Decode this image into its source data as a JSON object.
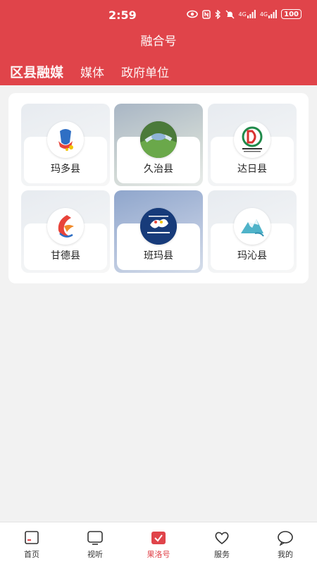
{
  "status_bar": {
    "time": "2:59",
    "icons": [
      "eye-icon",
      "nfc-icon",
      "bluetooth-icon",
      "mute-icon",
      "signal-4g-icon",
      "signal-4g-icon"
    ],
    "signal_label": "4G",
    "battery": "100"
  },
  "header": {
    "title": "融合号",
    "tabs": [
      {
        "label": "区县融媒",
        "active": true
      },
      {
        "label": "媒体",
        "active": false
      },
      {
        "label": "政府单位",
        "active": false
      }
    ]
  },
  "counties": [
    {
      "name": "玛多县",
      "icon": "maduo-logo-icon"
    },
    {
      "name": "久治县",
      "icon": "jiuzhi-logo-icon"
    },
    {
      "name": "达日县",
      "icon": "dari-logo-icon"
    },
    {
      "name": "甘德县",
      "icon": "gande-logo-icon"
    },
    {
      "name": "班玛县",
      "icon": "banma-logo-icon"
    },
    {
      "name": "玛沁县",
      "icon": "maqin-logo-icon"
    }
  ],
  "bottom_nav": [
    {
      "label": "首页",
      "icon": "home-icon"
    },
    {
      "label": "视听",
      "icon": "tv-icon"
    },
    {
      "label": "果洛号",
      "icon": "guoluo-icon",
      "active": true
    },
    {
      "label": "服务",
      "icon": "heart-icon"
    },
    {
      "label": "我的",
      "icon": "chat-bubble-icon"
    }
  ],
  "colors": {
    "brand": "#e0444a",
    "background": "#f2f2f2",
    "card_text": "#222222"
  }
}
